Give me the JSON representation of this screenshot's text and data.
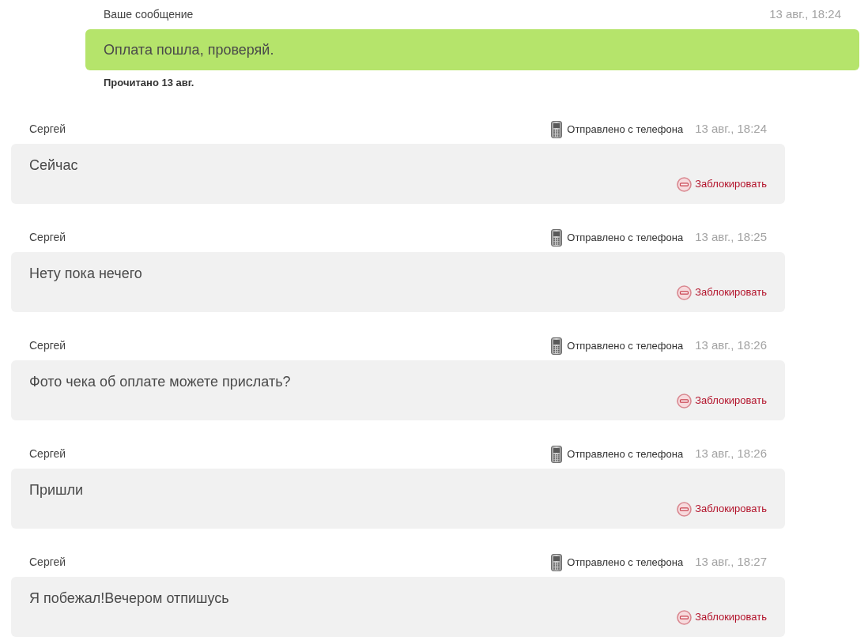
{
  "outgoing": {
    "sender": "Ваше сообщение",
    "time": "13 авг., 18:24",
    "text": "Оплата пошла, проверяй.",
    "read_status": "Прочитано 13 авг."
  },
  "incoming": [
    {
      "sender": "Сергей",
      "source": "Отправлено с телефона",
      "time": "13 авг., 18:24",
      "text": "Сейчас",
      "action": "Заблокировать"
    },
    {
      "sender": "Сергей",
      "source": "Отправлено с телефона",
      "time": "13 авг., 18:25",
      "text": "Нету пока нечего",
      "action": "Заблокировать"
    },
    {
      "sender": "Сергей",
      "source": "Отправлено с телефона",
      "time": "13 авг., 18:26",
      "text": "Фото чека об оплате можете прислать?",
      "action": "Заблокировать"
    },
    {
      "sender": "Сергей",
      "source": "Отправлено с телефона",
      "time": "13 авг., 18:26",
      "text": "Пришли",
      "action": "Заблокировать"
    },
    {
      "sender": "Сергей",
      "source": "Отправлено с телефона",
      "time": "13 авг., 18:27",
      "text": "Я побежал!Вечером отпишусь",
      "action": "Заблокировать"
    }
  ]
}
